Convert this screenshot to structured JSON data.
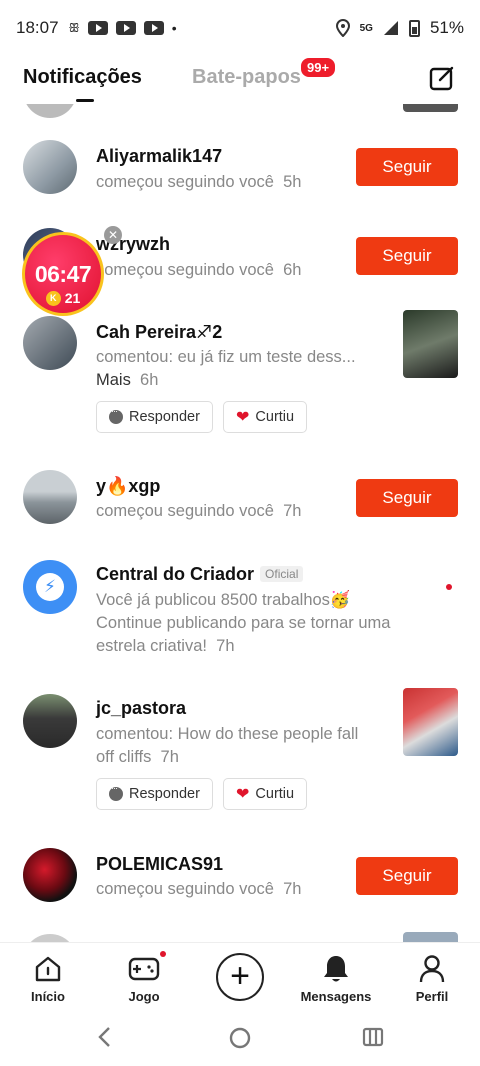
{
  "status_bar": {
    "time": "18:07",
    "network": "5G",
    "battery": "51%"
  },
  "header": {
    "tab_notifications": "Notificações",
    "tab_chats": "Bate-papos",
    "chats_badge": "99+"
  },
  "timer_widget": {
    "time": "06:47",
    "coins": "21",
    "coin_letter": "K"
  },
  "notifications": [
    {
      "name": "Aliyarmalik147",
      "text": "começou seguindo você",
      "time": "5h",
      "action": "Seguir"
    },
    {
      "name": "wzrywzh",
      "text": "começou seguindo você",
      "time": "6h",
      "action": "Seguir"
    },
    {
      "name": "Cah Pereira♐2",
      "text": "comentou: eu já fiz um teste dess...",
      "more": "Mais",
      "time": "6h",
      "reply": "Responder",
      "liked": "Curtiu"
    },
    {
      "name": "y🔥xgp",
      "text": "começou seguindo você",
      "time": "7h",
      "action": "Seguir"
    },
    {
      "name": "Central do Criador",
      "tag": "Oficial",
      "line1": "Você já publicou 8500 trabalhos🥳",
      "line2": "Continue publicando para se tornar uma",
      "line3": "estrela criativa!",
      "time": "7h"
    },
    {
      "name": "jc_pastora",
      "line1": "comentou: How do these people fall",
      "line2": "off cliffs",
      "time": "7h",
      "reply": "Responder",
      "liked": "Curtiu"
    },
    {
      "name": "POLEMICAS91",
      "text": "começou seguindo você",
      "time": "7h",
      "action": "Seguir"
    }
  ],
  "bottom_nav": {
    "home": "Início",
    "game": "Jogo",
    "messages": "Mensagens",
    "profile": "Perfil"
  },
  "colors": {
    "follow_button": "#ef3a12",
    "badge": "#ee1d2b",
    "timer": "#e0112f"
  }
}
